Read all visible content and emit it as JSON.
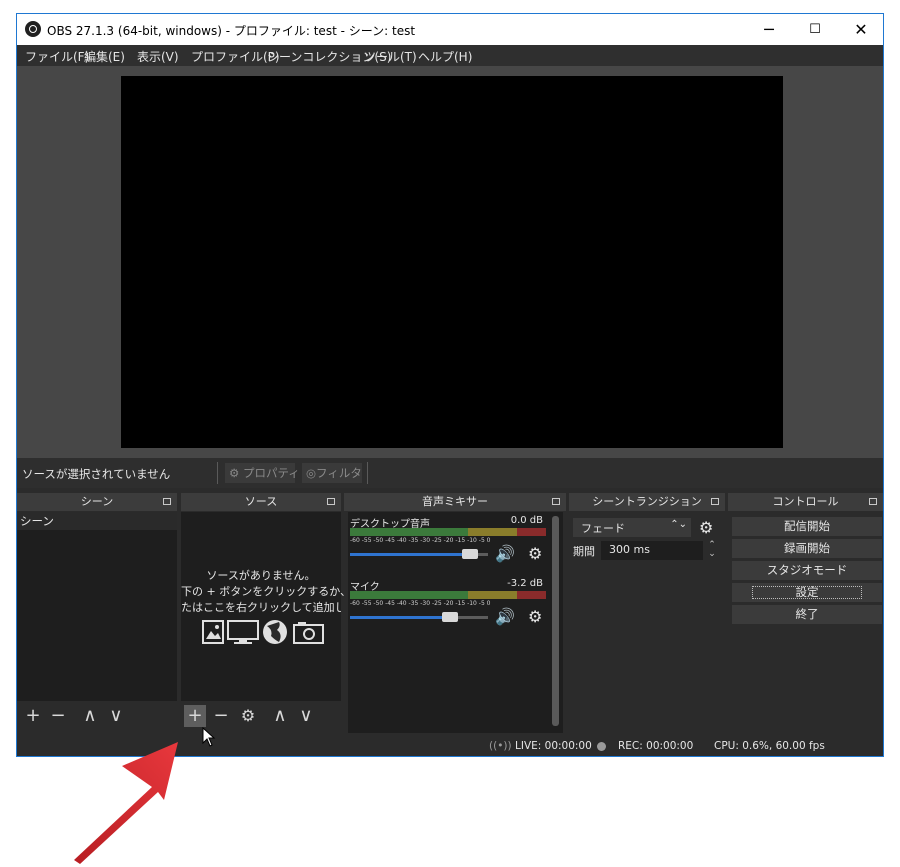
{
  "window": {
    "title": "OBS 27.1.3 (64-bit, windows) - プロファイル: test - シーン: test",
    "minimize": "─",
    "maximize": "☐",
    "close": "✕"
  },
  "menu": [
    "ファイル(F)",
    "編集(E)",
    "表示(V)",
    "プロファイル(P)",
    "シーンコレクション(S)",
    "ツール(T)",
    "ヘルプ(H)"
  ],
  "source_toolbar": {
    "status": "ソースが選択されていません",
    "properties": "プロパティ",
    "filters": "フィルタ"
  },
  "docks": {
    "scenes": {
      "title": "シーン",
      "items": [
        "シーン"
      ]
    },
    "sources": {
      "title": "ソース",
      "empty_lines": [
        "ソースがありません。",
        "下の + ボタンをクリックするか、",
        "たはここを右クリックして追加してください"
      ]
    },
    "mixer": {
      "title": "音声ミキサー",
      "channels": [
        {
          "name": "デスクトップ音声",
          "db": "0.0 dB",
          "volume": 0.93
        },
        {
          "name": "マイク",
          "db": "-3.2 dB",
          "volume": 0.78
        }
      ],
      "ticks": "-60 -55 -50 -45 -40 -35 -30 -25 -20 -15 -10 -5 0"
    },
    "transitions": {
      "title": "シーントランジション",
      "selected": "フェード",
      "duration_label": "期間",
      "duration_value": "300 ms"
    },
    "controls": {
      "title": "コントロール",
      "buttons": [
        "配信開始",
        "録画開始",
        "スタジオモード",
        "設定",
        "終了"
      ]
    }
  },
  "status": {
    "live": "LIVE: 00:00:00",
    "rec": "REC: 00:00:00",
    "cpu": "CPU: 0.6%, 60.00 fps"
  },
  "colors": {
    "accent": "#2f74d0",
    "annotation_arrow": "#d9262b"
  },
  "icons": {
    "add": "+",
    "remove": "−",
    "up": "∧",
    "down": "∨",
    "gear": "⚙",
    "speaker": "🔊"
  }
}
